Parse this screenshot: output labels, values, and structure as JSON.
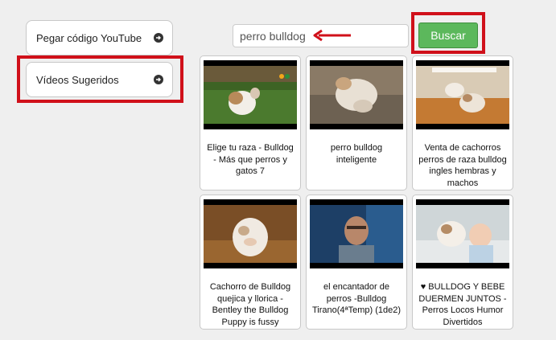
{
  "sidebar": {
    "items": [
      {
        "label": "Pegar código YouTube"
      },
      {
        "label": "Vídeos Sugeridos"
      }
    ]
  },
  "search": {
    "value": "perro bulldog",
    "button_label": "Buscar"
  },
  "videos": [
    {
      "title": "Elige tu raza - Bulldog - Más que perros y gatos 7"
    },
    {
      "title": "perro bulldog inteligente"
    },
    {
      "title": "Venta de cachorros perros de raza bulldog ingles hembras y machos"
    },
    {
      "title": "Cachorro de Bulldog quejica y llorica - Bentley the Bulldog Puppy is fussy"
    },
    {
      "title": "el encantador de perros -Bulldog Tirano(4ªTemp) (1de2)"
    },
    {
      "title": "♥ BULLDOG Y BEBE DUERMEN JUNTOS - Perros Locos Humor Divertidos"
    }
  ],
  "colors": {
    "highlight": "#d0101a",
    "search_button": "#5cb85c",
    "background": "#efefef"
  }
}
